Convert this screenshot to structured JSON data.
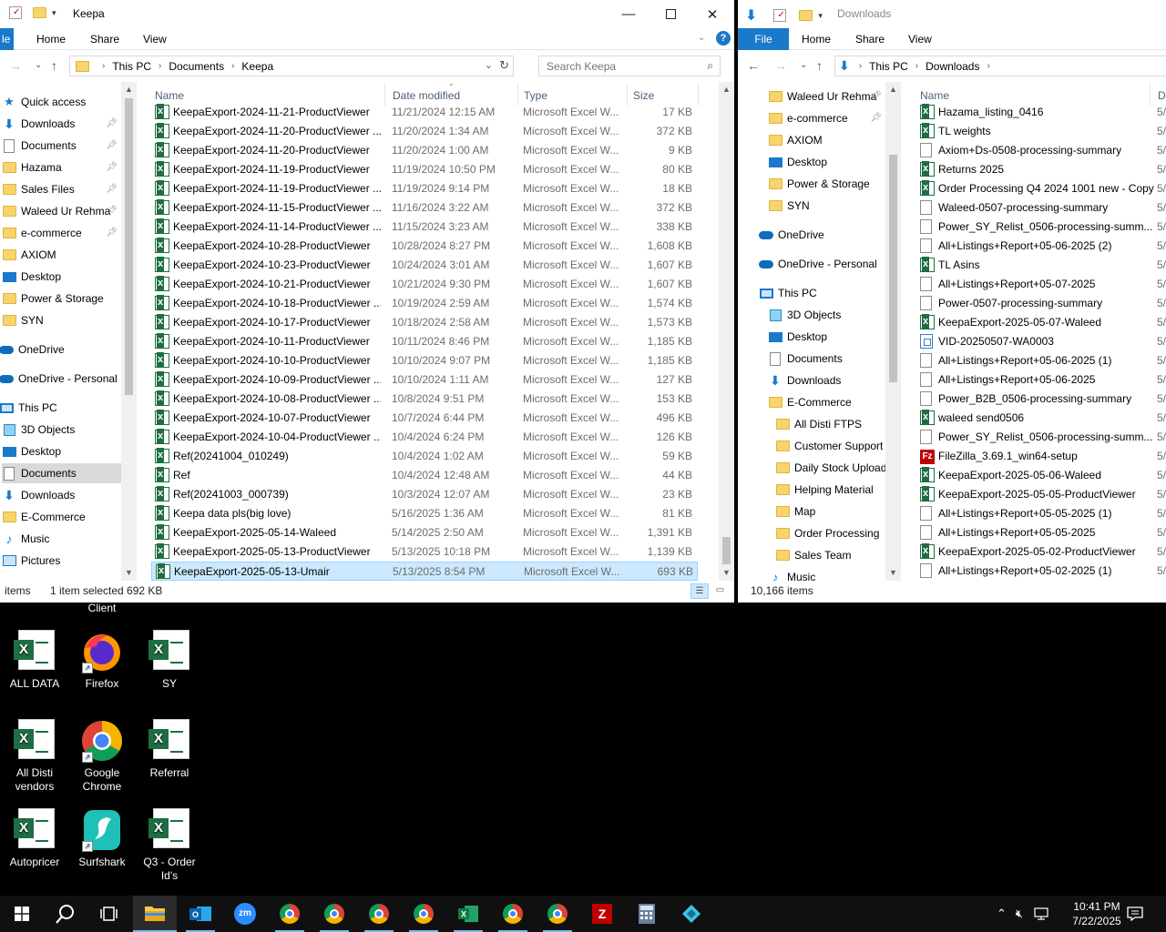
{
  "win1": {
    "title": "Keepa",
    "ribbon": [
      "Home",
      "Share",
      "View"
    ],
    "ribbon_partial": "le",
    "address": [
      "This PC",
      "Documents",
      "Keepa"
    ],
    "search_placeholder": "Search Keepa",
    "nav": [
      {
        "label": "Quick access",
        "icon": "star-icon",
        "pin": false
      },
      {
        "label": "Downloads",
        "icon": "download-icon",
        "pin": true
      },
      {
        "label": "Documents",
        "icon": "documents-icon",
        "pin": true
      },
      {
        "label": "Hazama",
        "icon": "folder-icon",
        "pin": true
      },
      {
        "label": "Sales Files",
        "icon": "folder-icon",
        "pin": true
      },
      {
        "label": "Waleed Ur Rehma",
        "icon": "folder-icon",
        "pin": true
      },
      {
        "label": "e-commerce",
        "icon": "folder-icon",
        "pin": true
      },
      {
        "label": "AXIOM",
        "icon": "folder-icon",
        "pin": false
      },
      {
        "label": "Desktop",
        "icon": "desktop-icon",
        "pin": false
      },
      {
        "label": "Power & Storage",
        "icon": "folder-icon",
        "pin": false
      },
      {
        "label": "SYN",
        "icon": "folder-icon",
        "pin": false
      },
      {
        "label": "OneDrive",
        "icon": "cloud-icon",
        "pin": false
      },
      {
        "label": "OneDrive - Personal",
        "icon": "cloud-icon",
        "pin": false
      },
      {
        "label": "This PC",
        "icon": "pc-icon",
        "pin": false
      },
      {
        "label": "3D Objects",
        "icon": "cube-icon",
        "pin": false
      },
      {
        "label": "Desktop",
        "icon": "desktop-icon",
        "pin": false
      },
      {
        "label": "Documents",
        "icon": "documents-icon",
        "pin": false
      },
      {
        "label": "Downloads",
        "icon": "download-icon",
        "pin": false
      },
      {
        "label": "E-Commerce",
        "icon": "folder-icon",
        "pin": false
      },
      {
        "label": "Music",
        "icon": "music-icon",
        "pin": false
      },
      {
        "label": "Pictures",
        "icon": "pictures-icon",
        "pin": false
      }
    ],
    "columns": [
      "Name",
      "Date modified",
      "Type",
      "Size"
    ],
    "files": [
      {
        "name": "KeepaExport-2024-11-21-ProductViewer",
        "date": "11/21/2024 12:15 AM",
        "type": "Microsoft Excel W...",
        "size": "17 KB"
      },
      {
        "name": "KeepaExport-2024-11-20-ProductViewer ...",
        "date": "11/20/2024 1:34 AM",
        "type": "Microsoft Excel W...",
        "size": "372 KB"
      },
      {
        "name": "KeepaExport-2024-11-20-ProductViewer",
        "date": "11/20/2024 1:00 AM",
        "type": "Microsoft Excel W...",
        "size": "9 KB"
      },
      {
        "name": "KeepaExport-2024-11-19-ProductViewer",
        "date": "11/19/2024 10:50 PM",
        "type": "Microsoft Excel W...",
        "size": "80 KB"
      },
      {
        "name": "KeepaExport-2024-11-19-ProductViewer ...",
        "date": "11/19/2024 9:14 PM",
        "type": "Microsoft Excel W...",
        "size": "18 KB"
      },
      {
        "name": "KeepaExport-2024-11-15-ProductViewer ...",
        "date": "11/16/2024 3:22 AM",
        "type": "Microsoft Excel W...",
        "size": "372 KB"
      },
      {
        "name": "KeepaExport-2024-11-14-ProductViewer ...",
        "date": "11/15/2024 3:23 AM",
        "type": "Microsoft Excel W...",
        "size": "338 KB"
      },
      {
        "name": "KeepaExport-2024-10-28-ProductViewer",
        "date": "10/28/2024 8:27 PM",
        "type": "Microsoft Excel W...",
        "size": "1,608 KB"
      },
      {
        "name": "KeepaExport-2024-10-23-ProductViewer",
        "date": "10/24/2024 3:01 AM",
        "type": "Microsoft Excel W...",
        "size": "1,607 KB"
      },
      {
        "name": "KeepaExport-2024-10-21-ProductViewer",
        "date": "10/21/2024 9:30 PM",
        "type": "Microsoft Excel W...",
        "size": "1,607 KB"
      },
      {
        "name": "KeepaExport-2024-10-18-ProductViewer ...",
        "date": "10/19/2024 2:59 AM",
        "type": "Microsoft Excel W...",
        "size": "1,574 KB"
      },
      {
        "name": "KeepaExport-2024-10-17-ProductViewer",
        "date": "10/18/2024 2:58 AM",
        "type": "Microsoft Excel W...",
        "size": "1,573 KB"
      },
      {
        "name": "KeepaExport-2024-10-11-ProductViewer",
        "date": "10/11/2024 8:46 PM",
        "type": "Microsoft Excel W...",
        "size": "1,185 KB"
      },
      {
        "name": "KeepaExport-2024-10-10-ProductViewer",
        "date": "10/10/2024 9:07 PM",
        "type": "Microsoft Excel W...",
        "size": "1,185 KB"
      },
      {
        "name": "KeepaExport-2024-10-09-ProductViewer ...",
        "date": "10/10/2024 1:11 AM",
        "type": "Microsoft Excel W...",
        "size": "127 KB"
      },
      {
        "name": "KeepaExport-2024-10-08-ProductViewer ...",
        "date": "10/8/2024 9:51 PM",
        "type": "Microsoft Excel W...",
        "size": "153 KB"
      },
      {
        "name": "KeepaExport-2024-10-07-ProductViewer",
        "date": "10/7/2024 6:44 PM",
        "type": "Microsoft Excel W...",
        "size": "496 KB"
      },
      {
        "name": "KeepaExport-2024-10-04-ProductViewer ...",
        "date": "10/4/2024 6:24 PM",
        "type": "Microsoft Excel W...",
        "size": "126 KB"
      },
      {
        "name": "Ref(20241004_010249)",
        "date": "10/4/2024 1:02 AM",
        "type": "Microsoft Excel W...",
        "size": "59 KB"
      },
      {
        "name": "Ref",
        "date": "10/4/2024 12:48 AM",
        "type": "Microsoft Excel W...",
        "size": "44 KB"
      },
      {
        "name": "Ref(20241003_000739)",
        "date": "10/3/2024 12:07 AM",
        "type": "Microsoft Excel W...",
        "size": "23 KB"
      },
      {
        "name": "Keepa data pls(big love)",
        "date": "5/16/2025 1:36 AM",
        "type": "Microsoft Excel W...",
        "size": "81 KB"
      },
      {
        "name": "KeepaExport-2025-05-14-Waleed",
        "date": "5/14/2025 2:50 AM",
        "type": "Microsoft Excel W...",
        "size": "1,391 KB"
      },
      {
        "name": "KeepaExport-2025-05-13-ProductViewer",
        "date": "5/13/2025 10:18 PM",
        "type": "Microsoft Excel W...",
        "size": "1,139 KB"
      },
      {
        "name": "KeepaExport-2025-05-13-Umair",
        "date": "5/13/2025 8:54 PM",
        "type": "Microsoft Excel W...",
        "size": "693 KB"
      }
    ],
    "status_items": "items",
    "status_selected": "1 item selected  692 KB"
  },
  "win2": {
    "title": "Downloads",
    "ribbon_file": "File",
    "ribbon": [
      "Home",
      "Share",
      "View"
    ],
    "address": [
      "This PC",
      "Downloads"
    ],
    "nav": [
      {
        "label": "Waleed Ur Rehma",
        "icon": "folder-icon",
        "pin": true
      },
      {
        "label": "e-commerce",
        "icon": "folder-icon",
        "pin": true
      },
      {
        "label": "AXIOM",
        "icon": "folder-icon",
        "pin": false
      },
      {
        "label": "Desktop",
        "icon": "desktop-icon",
        "pin": false
      },
      {
        "label": "Power & Storage",
        "icon": "folder-icon",
        "pin": false
      },
      {
        "label": "SYN",
        "icon": "folder-icon",
        "pin": false
      },
      {
        "label": "OneDrive",
        "icon": "cloud-icon",
        "pin": false
      },
      {
        "label": "OneDrive - Personal",
        "icon": "cloud-icon",
        "pin": false
      },
      {
        "label": "This PC",
        "icon": "pc-icon",
        "pin": false
      },
      {
        "label": "3D Objects",
        "icon": "cube-icon",
        "pin": false
      },
      {
        "label": "Desktop",
        "icon": "desktop-icon",
        "pin": false
      },
      {
        "label": "Documents",
        "icon": "documents-icon",
        "pin": false
      },
      {
        "label": "Downloads",
        "icon": "download-icon",
        "pin": false
      },
      {
        "label": "E-Commerce",
        "icon": "folder-icon",
        "pin": false
      },
      {
        "label": "All Disti FTPS",
        "icon": "folder-icon",
        "pin": false
      },
      {
        "label": "Customer Support",
        "icon": "folder-icon",
        "pin": false
      },
      {
        "label": "Daily Stock Uploads",
        "icon": "folder-icon",
        "pin": false
      },
      {
        "label": "Helping Material",
        "icon": "folder-icon",
        "pin": false
      },
      {
        "label": "Map",
        "icon": "folder-icon",
        "pin": false
      },
      {
        "label": "Order Processing",
        "icon": "folder-icon",
        "pin": false
      },
      {
        "label": "Sales Team",
        "icon": "folder-icon",
        "pin": false
      },
      {
        "label": "Music",
        "icon": "music-icon",
        "pin": false
      }
    ],
    "columns": [
      "Name",
      "D"
    ],
    "files": [
      {
        "name": "Hazama_listing_0416",
        "icon": "excel",
        "date": "5/"
      },
      {
        "name": "TL weights",
        "icon": "excel",
        "date": "5/"
      },
      {
        "name": "Axiom+Ds-0508-processing-summary",
        "icon": "doc",
        "date": "5/"
      },
      {
        "name": "Returns 2025",
        "icon": "excel",
        "date": "5/"
      },
      {
        "name": "Order Processing Q4 2024 1001 new - Copy",
        "icon": "excel",
        "date": "5/"
      },
      {
        "name": "Waleed-0507-processing-summary",
        "icon": "doc",
        "date": "5/"
      },
      {
        "name": "Power_SY_Relist_0506-processing-summ...",
        "icon": "doc",
        "date": "5/"
      },
      {
        "name": "All+Listings+Report+05-06-2025 (2)",
        "icon": "doc",
        "date": "5/"
      },
      {
        "name": "TL Asins",
        "icon": "excel",
        "date": "5/"
      },
      {
        "name": "All+Listings+Report+05-07-2025",
        "icon": "doc",
        "date": "5/"
      },
      {
        "name": "Power-0507-processing-summary",
        "icon": "doc",
        "date": "5/"
      },
      {
        "name": "KeepaExport-2025-05-07-Waleed",
        "icon": "excel",
        "date": "5/"
      },
      {
        "name": "VID-20250507-WA0003",
        "icon": "video",
        "date": "5/"
      },
      {
        "name": "All+Listings+Report+05-06-2025 (1)",
        "icon": "doc",
        "date": "5/"
      },
      {
        "name": "All+Listings+Report+05-06-2025",
        "icon": "doc",
        "date": "5/"
      },
      {
        "name": "Power_B2B_0506-processing-summary",
        "icon": "doc",
        "date": "5/"
      },
      {
        "name": "waleed send0506",
        "icon": "excel",
        "date": "5/"
      },
      {
        "name": "Power_SY_Relist_0506-processing-summ...",
        "icon": "doc",
        "date": "5/"
      },
      {
        "name": "FileZilla_3.69.1_win64-setup",
        "icon": "filezilla",
        "date": "5/"
      },
      {
        "name": "KeepaExport-2025-05-06-Waleed",
        "icon": "excel",
        "date": "5/"
      },
      {
        "name": "KeepaExport-2025-05-05-ProductViewer",
        "icon": "excel",
        "date": "5/"
      },
      {
        "name": "All+Listings+Report+05-05-2025 (1)",
        "icon": "doc",
        "date": "5/"
      },
      {
        "name": "All+Listings+Report+05-05-2025",
        "icon": "doc",
        "date": "5/"
      },
      {
        "name": "KeepaExport-2025-05-02-ProductViewer",
        "icon": "excel",
        "date": "5/"
      },
      {
        "name": "All+Listings+Report+05-02-2025 (1)",
        "icon": "doc",
        "date": "5/"
      }
    ],
    "status": "10,166 items"
  },
  "desktop": {
    "top_partial_label": "Client",
    "icons": [
      {
        "label": "ALL DATA",
        "kind": "excel"
      },
      {
        "label": "Firefox",
        "kind": "firefox"
      },
      {
        "label": "SY",
        "kind": "excel"
      },
      {
        "label": "All Disti vendors",
        "kind": "excel"
      },
      {
        "label": "Google Chrome",
        "kind": "chrome"
      },
      {
        "label": "Referral",
        "kind": "excel"
      },
      {
        "label": "Autopricer",
        "kind": "excel"
      },
      {
        "label": "Surfshark",
        "kind": "surfshark"
      },
      {
        "label": "Q3 - Order Id's",
        "kind": "excel"
      }
    ]
  },
  "taskbar": {
    "time": "10:41 PM",
    "date": "7/22/2025",
    "zoom_label": "zm"
  },
  "colors": {
    "accent": "#1979ca",
    "selection": "#cce8ff",
    "excel": "#1f6e43",
    "taskbar": "#101010"
  }
}
